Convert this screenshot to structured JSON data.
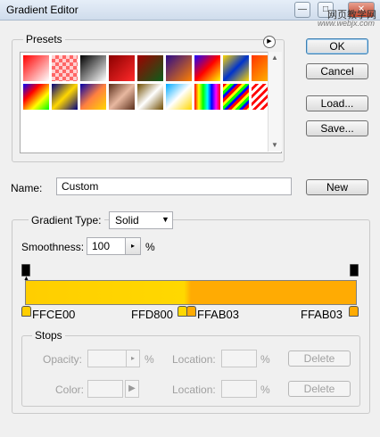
{
  "window": {
    "title": "Gradient Editor"
  },
  "watermark": {
    "line1": "网页教学网",
    "line2": "www.webjx.com"
  },
  "title_buttons": {
    "minimize": "—",
    "maximize": "□",
    "close": "✕"
  },
  "presets": {
    "label": "Presets",
    "swatches": [
      "linear-gradient(135deg,#ff0000,#ffffff)",
      "repeating-conic-gradient(#ff6666 0 25%, #ffd0d0 0 50%) 0 0/8px 8px",
      "linear-gradient(135deg,#000000,#ffffff)",
      "linear-gradient(135deg,#8b0000,#ff2a2a)",
      "linear-gradient(135deg,#a00000,#0a5f1a)",
      "linear-gradient(135deg,#2b0b8a,#ff8000)",
      "linear-gradient(135deg,#1a00ff,#ff0000,#ffff00)",
      "linear-gradient(135deg,#ffd800,#0033cc,#ffd800)",
      "linear-gradient(135deg,#ff3300,#ffcc00)",
      "linear-gradient(135deg,#0000ff,#ff0000,#ffff00,#00ff00)",
      "linear-gradient(135deg,#000080,#ffd700,#000080)",
      "linear-gradient(135deg,#0000aa,#ff8040,#ffd700)",
      "linear-gradient(135deg,#5a2e1a,#e8b8a0,#5a2e1a)",
      "linear-gradient(135deg,#6f4d00,#ffffff,#6f4d00)",
      "linear-gradient(135deg,#00aaff,#ffffff,#ffd700)",
      "linear-gradient(90deg,#ff0000,#ffff00,#00ff00,#00ffff,#0000ff,#ff00ff,#ff0000)",
      "repeating-linear-gradient(135deg,#ff0000 0 3px,#ffff00 3px 6px,#00ff00 6px 9px,#0000ff 9px 12px)",
      "repeating-linear-gradient(135deg,#ffffff 0 3px,#ff0000 3px 6px)"
    ]
  },
  "buttons": {
    "ok": "OK",
    "cancel": "Cancel",
    "load": "Load...",
    "save": "Save...",
    "new": "New"
  },
  "name": {
    "label": "Name:",
    "value": "Custom"
  },
  "gradient": {
    "type_label": "Gradient Type:",
    "type_value": "Solid",
    "smoothness_label": "Smoothness:",
    "smoothness_value": "100",
    "smoothness_unit": "%",
    "bar": "linear-gradient(90deg,#ffce00 0%,#ffd800 48%,#ffab03 50%,#ffab03 100%)",
    "stops": [
      "FFCE00",
      "FFD800",
      "FFAB03",
      "FFAB03"
    ],
    "stop_colors": [
      "#ffce00",
      "#ffd800",
      "#ffab03",
      "#ffab03"
    ]
  },
  "stops_group": {
    "label": "Stops",
    "opacity_label": "Opacity:",
    "opacity_unit": "%",
    "color_label": "Color:",
    "location_label": "Location:",
    "location_unit": "%",
    "delete_label": "Delete"
  }
}
